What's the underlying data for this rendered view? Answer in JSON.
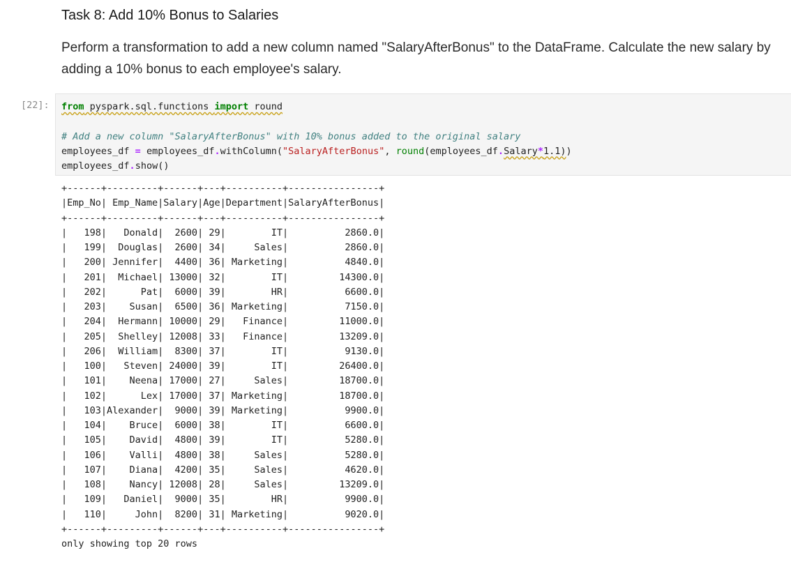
{
  "markdown": {
    "heading": "Task 8: Add 10% Bonus to Salaries",
    "paragraph": "Perform a transformation to add a new column named \"SalaryAfterBonus\" to the DataFrame. Calculate the new salary by adding a 10% bonus to each employee's salary."
  },
  "cell": {
    "prompt": "[22]:",
    "import_line": "from pyspark.sql.functions import round",
    "comment_line": "# Add a new column \"SalaryAfterBonus\" with 10% bonus added to the original salary",
    "assign_line": "employees_df = employees_df.withColumn(\"SalaryAfterBonus\", round(employees_df.Salary*1.1))",
    "show_line": "employees_df.show()"
  },
  "table": {
    "columns": [
      "Emp_No",
      "Emp_Name",
      "Salary",
      "Age",
      "Department",
      "SalaryAfterBonus"
    ],
    "rows": [
      [
        "198",
        "Donald",
        "2600",
        "29",
        "IT",
        "2860.0"
      ],
      [
        "199",
        "Douglas",
        "2600",
        "34",
        "Sales",
        "2860.0"
      ],
      [
        "200",
        "Jennifer",
        "4400",
        "36",
        "Marketing",
        "4840.0"
      ],
      [
        "201",
        "Michael",
        "13000",
        "32",
        "IT",
        "14300.0"
      ],
      [
        "202",
        "Pat",
        "6000",
        "39",
        "HR",
        "6600.0"
      ],
      [
        "203",
        "Susan",
        "6500",
        "36",
        "Marketing",
        "7150.0"
      ],
      [
        "204",
        "Hermann",
        "10000",
        "29",
        "Finance",
        "11000.0"
      ],
      [
        "205",
        "Shelley",
        "12008",
        "33",
        "Finance",
        "13209.0"
      ],
      [
        "206",
        "William",
        "8300",
        "37",
        "IT",
        "9130.0"
      ],
      [
        "100",
        "Steven",
        "24000",
        "39",
        "IT",
        "26400.0"
      ],
      [
        "101",
        "Neena",
        "17000",
        "27",
        "Sales",
        "18700.0"
      ],
      [
        "102",
        "Lex",
        "17000",
        "37",
        "Marketing",
        "18700.0"
      ],
      [
        "103",
        "Alexander",
        "9000",
        "39",
        "Marketing",
        "9900.0"
      ],
      [
        "104",
        "Bruce",
        "6000",
        "38",
        "IT",
        "6600.0"
      ],
      [
        "105",
        "David",
        "4800",
        "39",
        "IT",
        "5280.0"
      ],
      [
        "106",
        "Valli",
        "4800",
        "38",
        "Sales",
        "5280.0"
      ],
      [
        "107",
        "Diana",
        "4200",
        "35",
        "Sales",
        "4620.0"
      ],
      [
        "108",
        "Nancy",
        "12008",
        "28",
        "Sales",
        "13209.0"
      ],
      [
        "109",
        "Daniel",
        "9000",
        "35",
        "HR",
        "9900.0"
      ],
      [
        "110",
        "John",
        "8200",
        "31",
        "Marketing",
        "9020.0"
      ]
    ],
    "footer": "only showing top 20 rows"
  }
}
